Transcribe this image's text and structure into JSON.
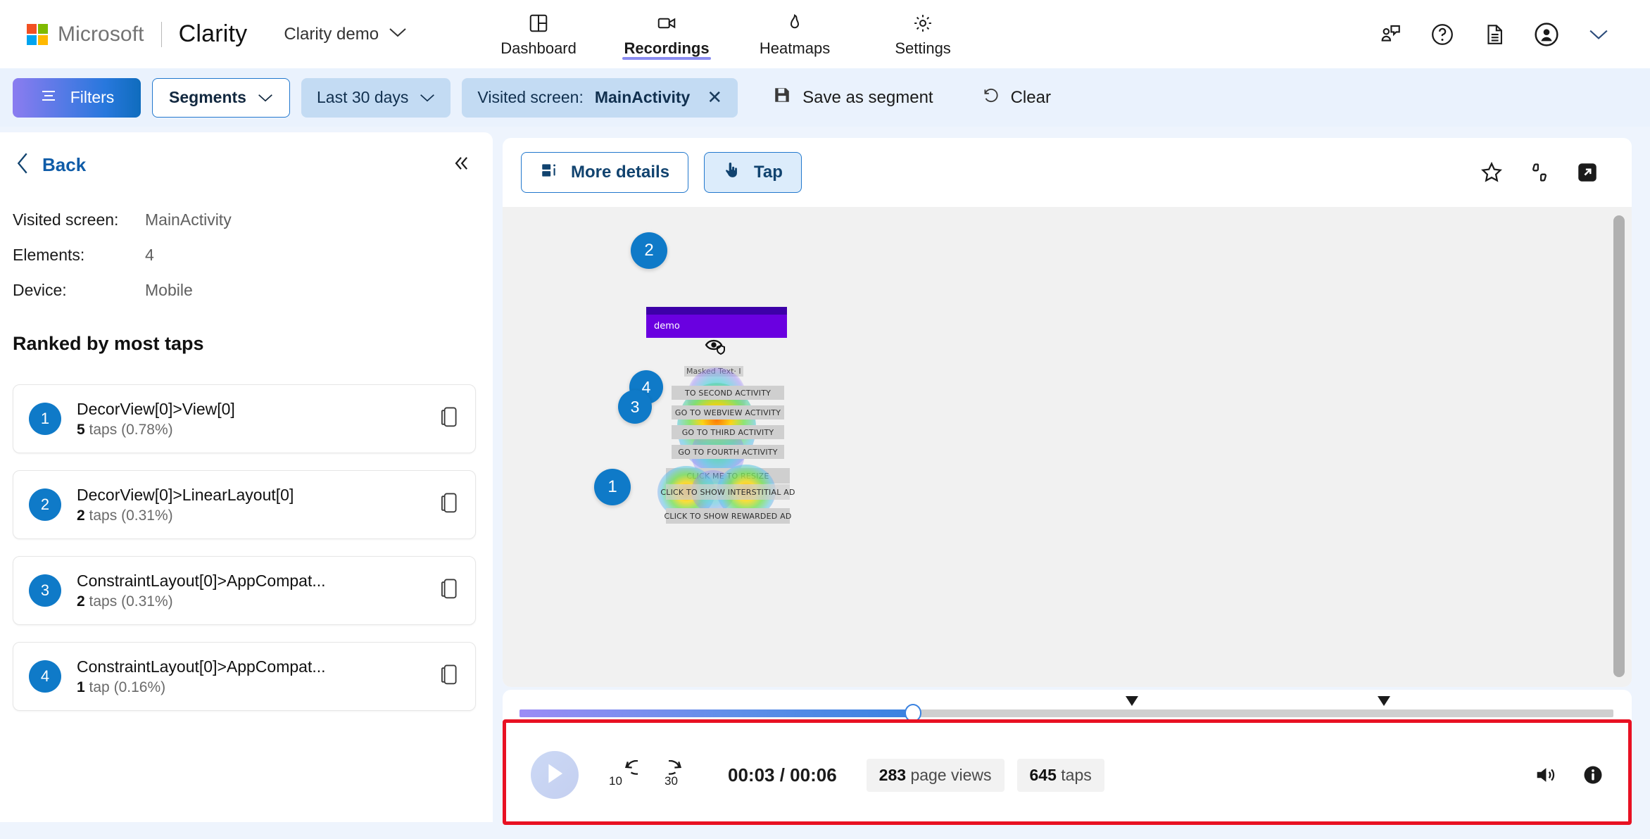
{
  "header": {
    "ms_word": "Microsoft",
    "brand": "Clarity",
    "project": "Clarity demo",
    "nav": [
      {
        "label": "Dashboard",
        "icon": "dashboard-icon",
        "active": false
      },
      {
        "label": "Recordings",
        "icon": "video-camera-icon",
        "active": true
      },
      {
        "label": "Heatmaps",
        "icon": "flame-icon",
        "active": false
      },
      {
        "label": "Settings",
        "icon": "gear-icon",
        "active": false
      }
    ],
    "right_icons": [
      "feedback-icon",
      "help-icon",
      "docs-icon",
      "account-icon",
      "chevron-down-icon"
    ]
  },
  "filterbar": {
    "filters_label": "Filters",
    "segments_label": "Segments",
    "date_range": "Last 30 days",
    "applied_filter_label": "Visited screen:",
    "applied_filter_value": "MainActivity",
    "save_segment_label": "Save as segment",
    "clear_label": "Clear"
  },
  "left_panel": {
    "back_label": "Back",
    "meta": [
      {
        "label": "Visited screen:",
        "value": "MainActivity"
      },
      {
        "label": "Elements:",
        "value": "4"
      },
      {
        "label": "Device:",
        "value": "Mobile"
      }
    ],
    "ranked_title": "Ranked by most taps",
    "items": [
      {
        "rank": "1",
        "selector": "DecorView[0]>View[0]",
        "count": "5",
        "unit": "taps",
        "pct": "(0.78%)"
      },
      {
        "rank": "2",
        "selector": "DecorView[0]>LinearLayout[0]",
        "count": "2",
        "unit": "taps",
        "pct": "(0.31%)"
      },
      {
        "rank": "3",
        "selector": "ConstraintLayout[0]>AppCompat...",
        "count": "2",
        "unit": "taps",
        "pct": "(0.31%)"
      },
      {
        "rank": "4",
        "selector": "ConstraintLayout[0]>AppCompat...",
        "count": "1",
        "unit": "tap",
        "pct": "(0.16%)"
      }
    ]
  },
  "content": {
    "more_details_label": "More details",
    "tap_label": "Tap",
    "right_icons": [
      "favorite-star-icon",
      "thumbs-feedback-icon",
      "open-external-icon"
    ]
  },
  "app_preview": {
    "app_title": "demo",
    "masked_text": "Masked Text· I",
    "buttons": [
      "TO SECOND ACTIVITY",
      "GO TO WEBVIEW ACTIVITY",
      "GO TO THIRD ACTIVITY",
      "GO TO FOURTH ACTIVITY",
      "CLICK ME TO RESIZE",
      "CLICK TO SHOW INTERSTITIAL AD",
      "CLICK TO SHOW REWARDED AD"
    ],
    "badges": [
      "2",
      "4",
      "3",
      "1"
    ]
  },
  "player": {
    "time": "00:03 / 00:06",
    "rewind_label": "10",
    "forward_label": "30",
    "page_views_count": "283",
    "page_views_label": "page views",
    "taps_count": "645",
    "taps_label": "taps",
    "progress_percent": 36,
    "markers_percent": [
      56,
      79
    ],
    "icons": [
      "volume-icon",
      "info-icon",
      "play-icon"
    ]
  },
  "colors": {
    "accent_blue": "#0f7ac8",
    "brand_purple": "#6a00e0",
    "highlight_red": "#e81123"
  }
}
